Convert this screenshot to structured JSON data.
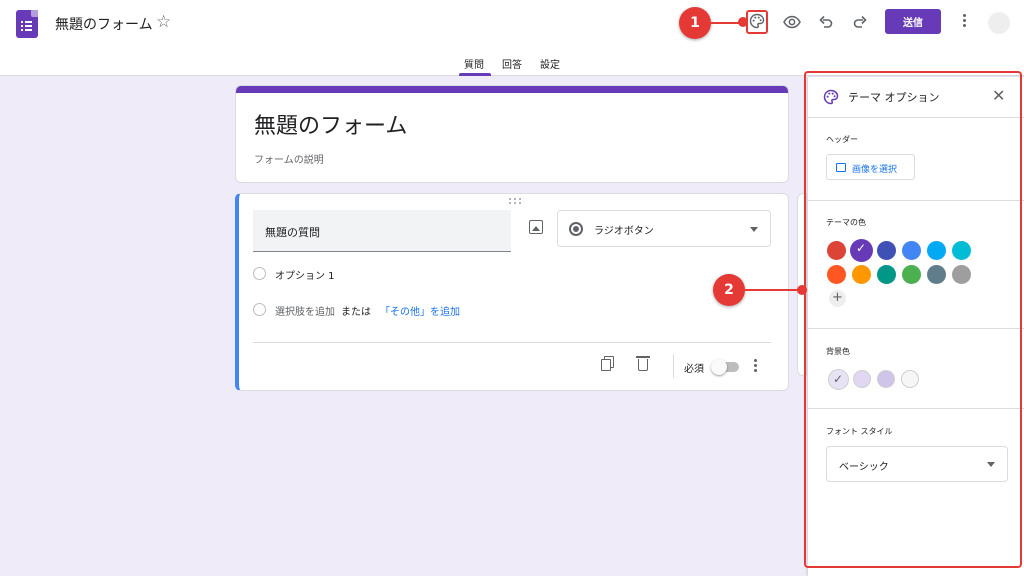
{
  "header": {
    "doc_title": "無題のフォーム",
    "send_label": "送信"
  },
  "tabs": [
    {
      "label": "質問",
      "active": true
    },
    {
      "label": "回答",
      "active": false
    },
    {
      "label": "設定",
      "active": false
    }
  ],
  "markers": [
    "1",
    "2"
  ],
  "form": {
    "title": "無題のフォーム",
    "description_placeholder": "フォームの説明"
  },
  "question": {
    "title": "無題の質問",
    "type_label": "ラジオボタン",
    "option1": "オプション 1",
    "add_option": "選択肢を追加",
    "or_text": "または",
    "add_other": "「その他」を追加",
    "required_label": "必須",
    "required": false
  },
  "theme_panel": {
    "title": "テーマ オプション",
    "header_label": "ヘッダー",
    "select_image_label": "画像を選択",
    "theme_color_label": "テーマの色",
    "background_color_label": "背景色",
    "font_style_label": "フォント スタイル",
    "font_style_value": "ベーシック"
  },
  "colors": {
    "brand": "#673ab7",
    "accent_blue": "#4285f4",
    "marker_red": "#e53935",
    "theme_swatches_row1": [
      "#db4437",
      "#673ab7",
      "#3f51b5",
      "#4285f4",
      "#03a9f4",
      "#00bcd4"
    ],
    "theme_swatches_row2": [
      "#ff5722",
      "#ff9800",
      "#009688",
      "#4caf50",
      "#607d8b",
      "#9e9e9e"
    ],
    "background_swatches": [
      "#e8e3f4",
      "#e1d7f2",
      "#d1c4e9",
      "#f6f6f6"
    ]
  }
}
